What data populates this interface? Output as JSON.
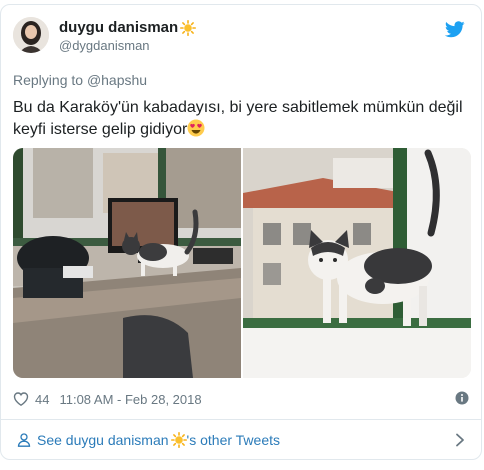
{
  "user": {
    "display_name": "duygu danisman",
    "handle": "@dygdanisman"
  },
  "reply": {
    "prefix": "Replying to",
    "to": "@hapshu"
  },
  "tweet": {
    "line1": "Bu da Karaköy'ün kabadayısı, bi yere sabitlemek mümkün değil",
    "line2": "keyfi isterse gelip gidiyor"
  },
  "meta": {
    "likes": "44",
    "timestamp": "11:08 AM - Feb 28, 2018"
  },
  "footer": {
    "prefix": "See duygu danisman",
    "suffix": "'s other Tweets"
  },
  "icons": {
    "brand": "twitter-bird-icon",
    "like": "heart-icon",
    "info": "info-icon",
    "profile": "person-icon",
    "next": "chevron-right-icon"
  },
  "colors": {
    "link": "#2b7bb9",
    "twitter_blue": "#1da1f2",
    "muted": "#697882",
    "border": "#e1e8ed"
  }
}
